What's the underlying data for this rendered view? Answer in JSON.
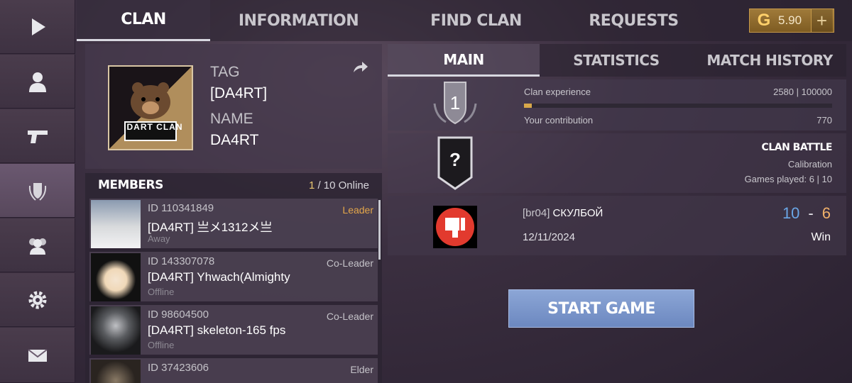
{
  "sidebar": {
    "items": [
      {
        "name": "play",
        "icon": "play-icon",
        "active": false
      },
      {
        "name": "profile",
        "icon": "person-icon",
        "active": false
      },
      {
        "name": "weapons",
        "icon": "pistol-icon",
        "active": false
      },
      {
        "name": "clan",
        "icon": "shield-laurel-icon",
        "active": true
      },
      {
        "name": "friends",
        "icon": "group-icon",
        "active": false
      },
      {
        "name": "settings",
        "icon": "gear-icon",
        "active": false
      },
      {
        "name": "mail",
        "icon": "envelope-icon",
        "active": false
      }
    ]
  },
  "top_tabs": [
    {
      "label": "CLAN",
      "active": true
    },
    {
      "label": "INFORMATION",
      "active": false
    },
    {
      "label": "FIND CLAN",
      "active": false
    },
    {
      "label": "REQUESTS",
      "active": false
    }
  ],
  "currency": {
    "symbol": "G",
    "amount": "5.90",
    "plus": "+"
  },
  "clan": {
    "tag_label": "TAG",
    "tag": "[DA4RT]",
    "name_label": "NAME",
    "name": "DA4RT",
    "logo_text": "DART CLAN"
  },
  "members": {
    "title": "MEMBERS",
    "online_count": "1",
    "online_total": "/ 10 Online",
    "list": [
      {
        "id": "ID 110341849",
        "name": "[DA4RT] 亗メ1312メ亗",
        "status": "Away",
        "role": "Leader"
      },
      {
        "id": "ID 143307078",
        "name": "[DA4RT] Yhwach(Almighty",
        "status": "Offline",
        "role": "Co-Leader"
      },
      {
        "id": "ID 98604500",
        "name": "[DA4RT] skeleton-165 fps",
        "status": "Offline",
        "role": "Co-Leader"
      },
      {
        "id": "ID 37423606",
        "name": "",
        "status": "",
        "role": "Elder"
      }
    ]
  },
  "right_tabs": [
    {
      "label": "MAIN",
      "active": true
    },
    {
      "label": "STATISTICS",
      "active": false
    },
    {
      "label": "MATCH HISTORY",
      "active": false
    }
  ],
  "level": {
    "value": "1"
  },
  "experience": {
    "label": "Clan experience",
    "value": "2580 | 100000",
    "progress_fraction": 0.0258,
    "contribution_label": "Your contribution",
    "contribution_value": "770"
  },
  "battle": {
    "badge": "?",
    "title": "CLAN BATTLE",
    "subtitle": "Calibration",
    "games": "Games played: 6 | 10"
  },
  "last_match": {
    "opponent_tag": "[br04]",
    "opponent_name": "СКУЛБОЙ",
    "date": "12/11/2024",
    "score_own": "10",
    "score_sep": "-",
    "score_opp": "6",
    "result": "Win"
  },
  "start_button": {
    "label": "START GAME"
  }
}
